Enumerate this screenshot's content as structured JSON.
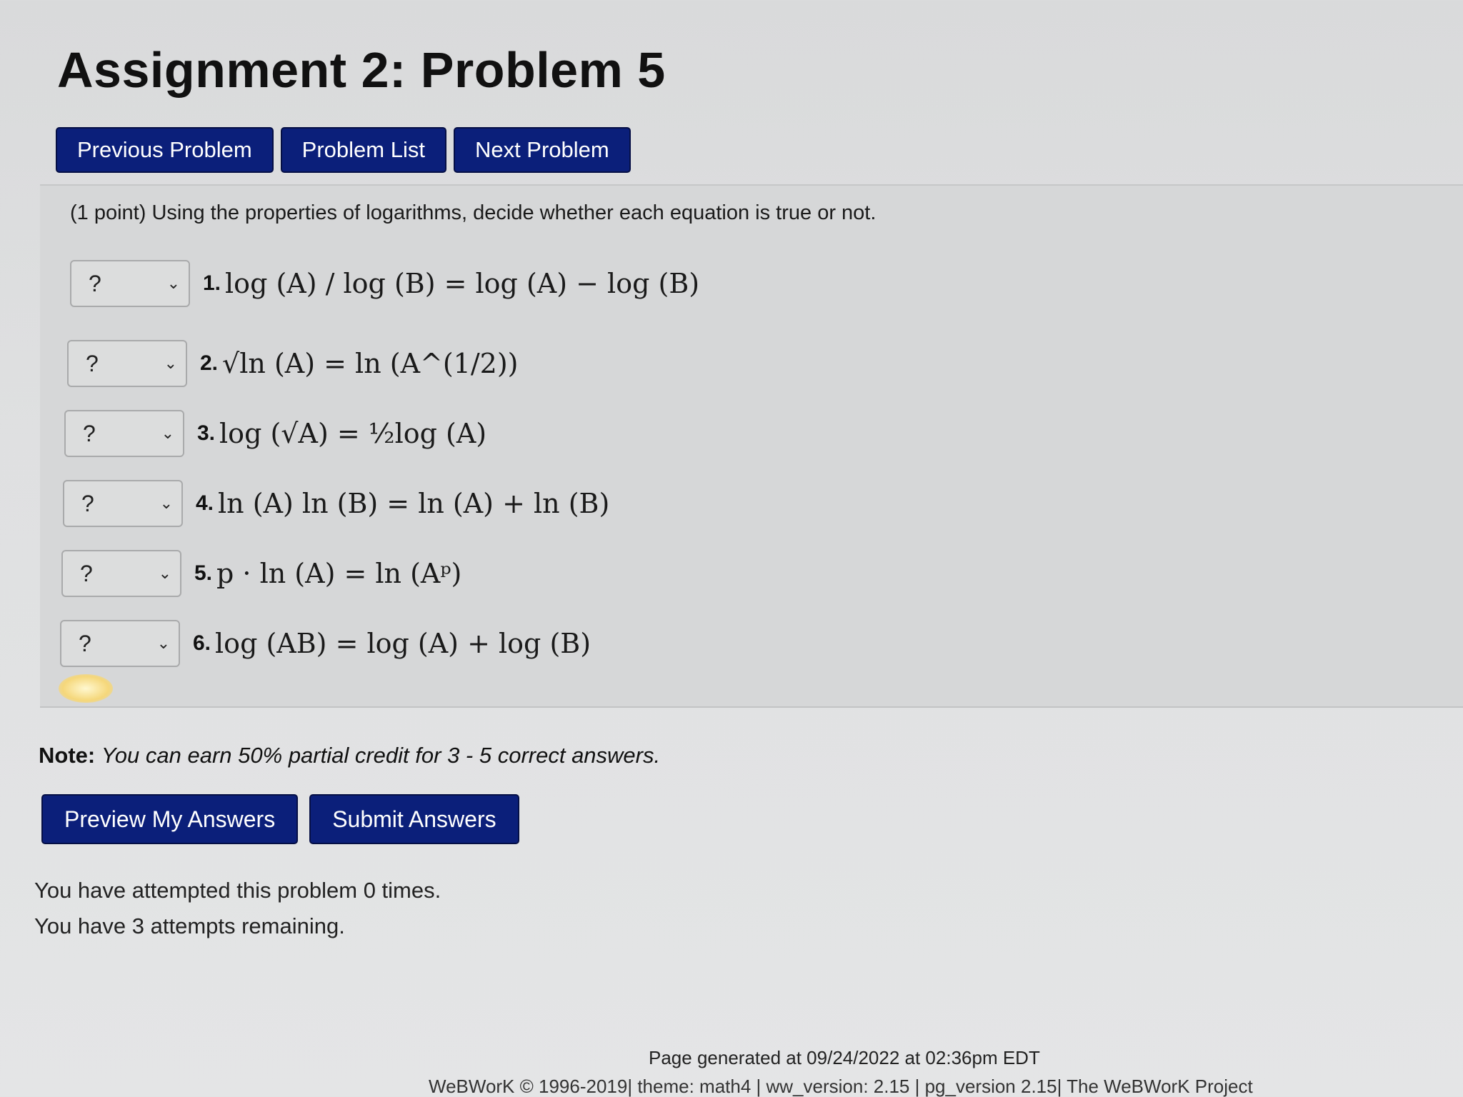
{
  "header": {
    "title": "Assignment 2: Problem 5"
  },
  "nav": {
    "previous": "Previous Problem",
    "list": "Problem List",
    "next": "Next Problem"
  },
  "problem": {
    "instructions": "(1 point) Using the properties of logarithms, decide whether each equation is true or not.",
    "equations": [
      {
        "number": "1.",
        "selected": "?",
        "text": "log (A) / log (B) = log (A) − log (B)"
      },
      {
        "number": "2.",
        "selected": "?",
        "text": "√ln (A) = ln (A^(1/2))"
      },
      {
        "number": "3.",
        "selected": "?",
        "text": "log (√A) = ½log (A)"
      },
      {
        "number": "4.",
        "selected": "?",
        "text": "ln (A) ln (B) = ln (A) + ln (B)"
      },
      {
        "number": "5.",
        "selected": "?",
        "text": "p · ln (A) = ln (Aᵖ)"
      },
      {
        "number": "6.",
        "selected": "?",
        "text": "log (AB) = log (A) + log (B)"
      }
    ]
  },
  "note": {
    "label": "Note:",
    "text": "You can earn 50% partial credit for 3 - 5 correct answers."
  },
  "actions": {
    "preview": "Preview My Answers",
    "submit": "Submit Answers"
  },
  "status": {
    "attempted": "You have attempted this problem 0 times.",
    "remaining": "You have 3 attempts remaining."
  },
  "footer": {
    "generated": "Page generated at 09/24/2022 at 02:36pm EDT",
    "credits": "WeBWorK © 1996-2019| theme: math4 | ww_version: 2.15 | pg_version 2.15| The WeBWorK Project"
  }
}
